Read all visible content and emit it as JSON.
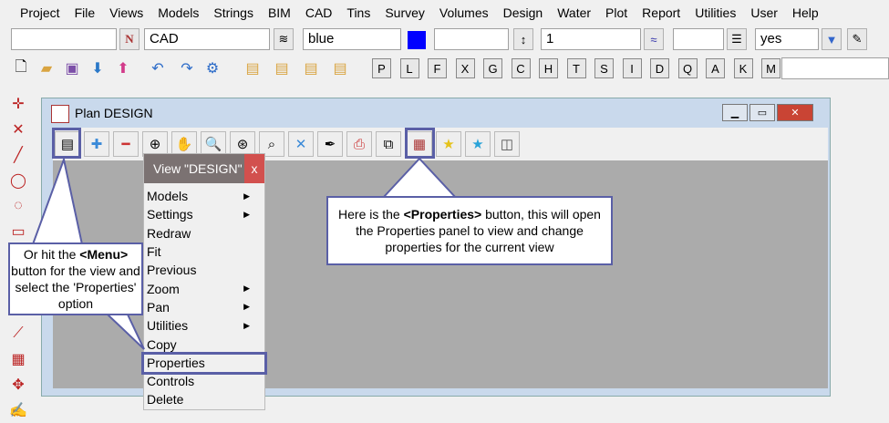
{
  "menubar": [
    "Project",
    "File",
    "Views",
    "Models",
    "Strings",
    "BIM",
    "CAD",
    "Tins",
    "Survey",
    "Volumes",
    "Design",
    "Water",
    "Plot",
    "Report",
    "Utilities",
    "User",
    "Help"
  ],
  "toolbar1": {
    "model": "CAD",
    "colour": "blue",
    "colour_swatch": "#0000ff",
    "weight": "1",
    "visible": "yes"
  },
  "toolbar2": {
    "letters": [
      "P",
      "L",
      "F",
      "X",
      "G",
      "C",
      "H",
      "T",
      "S",
      "I",
      "D",
      "Q",
      "A",
      "K",
      "M"
    ]
  },
  "window": {
    "title": "Plan DESIGN"
  },
  "popup": {
    "title": "View \"DESIGN\"",
    "close": "x",
    "items": [
      {
        "label": "Models",
        "sub": true
      },
      {
        "label": "Settings",
        "sub": true
      },
      {
        "label": "Redraw"
      },
      {
        "label": "Fit"
      },
      {
        "label": "Previous"
      },
      {
        "label": "Zoom",
        "sub": true
      },
      {
        "label": "Pan",
        "sub": true
      },
      {
        "label": "Utilities",
        "sub": true
      },
      {
        "label": "Copy"
      },
      {
        "label": "Properties"
      },
      {
        "label": "Controls"
      },
      {
        "label": "Delete"
      }
    ]
  },
  "callouts": {
    "menu_pre": "Or hit the ",
    "menu_bold": "<Menu>",
    "menu_post": " button for the view and select the 'Properties' option",
    "props_pre": "Here is the ",
    "props_bold": "<Properties>",
    "props_post": " button, this will open the Properties panel to view and change properties for the current view"
  },
  "accent": "#5a5fa6"
}
